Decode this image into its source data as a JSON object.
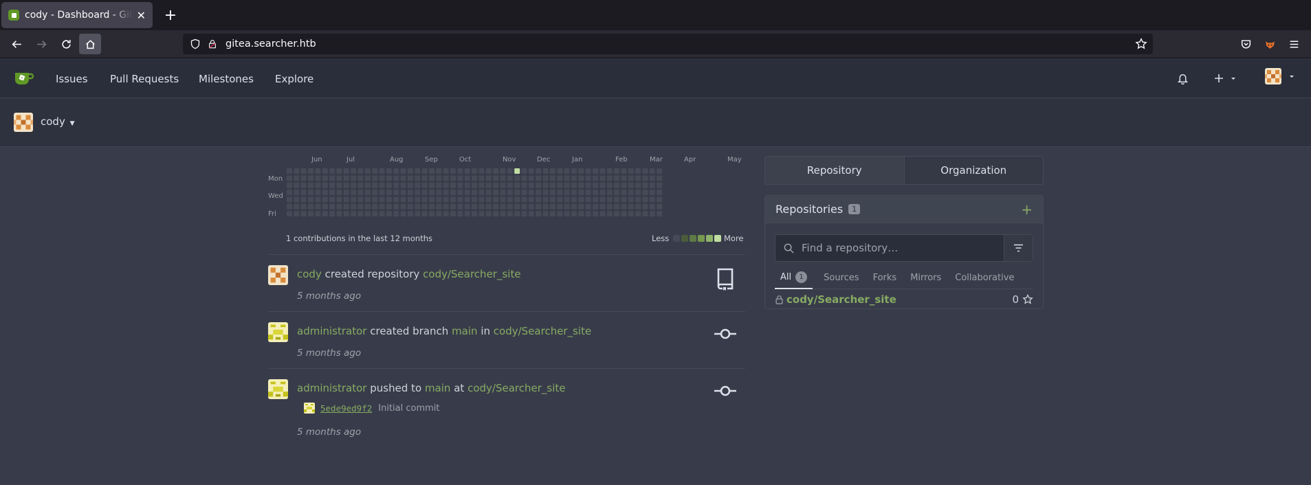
{
  "browser": {
    "tab_title": "cody - Dashboard - Gitea",
    "url": "gitea.searcher.htb"
  },
  "header": {
    "nav": [
      "Issues",
      "Pull Requests",
      "Milestones",
      "Explore"
    ]
  },
  "context_user": {
    "name": "cody"
  },
  "heatmap": {
    "months": [
      "Jun",
      "Jul",
      "Aug",
      "Sep",
      "Oct",
      "Nov",
      "Dec",
      "Jan",
      "Feb",
      "Mar",
      "Apr",
      "May"
    ],
    "days": [
      "Mon",
      "Wed",
      "Fri"
    ],
    "summary": "1 contributions in the last 12 months",
    "less": "Less",
    "more": "More",
    "colors": {
      "empty": "#454a57",
      "levels": [
        "#4b5c3a",
        "#5f7a45",
        "#76984f",
        "#8eb36b",
        "#c0dea2"
      ]
    }
  },
  "feed": [
    {
      "actor": "cody",
      "action": "created repository",
      "repo": "cody/Searcher_site",
      "time": "5 months ago",
      "icon": "repo-icon"
    },
    {
      "actor": "administrator",
      "action": "created branch",
      "branch": "main",
      "prep": "in",
      "repo": "cody/Searcher_site",
      "time": "5 months ago",
      "icon": "git-commit-icon"
    },
    {
      "actor": "administrator",
      "action": "pushed to",
      "branch": "main",
      "prep": "at",
      "repo": "cody/Searcher_site",
      "commit_sha": "5ede9ed9f2",
      "commit_msg": "Initial commit",
      "time": "5 months ago",
      "icon": "git-commit-icon"
    }
  ],
  "right": {
    "toggle": [
      "Repository",
      "Organization"
    ],
    "repos_title": "Repositories",
    "repos_count": "1",
    "search_placeholder": "Find a repository…",
    "tabs": [
      "All",
      "Sources",
      "Forks",
      "Mirrors",
      "Collaborative"
    ],
    "all_count": "1",
    "repo_name": "cody/Searcher_site",
    "repo_stars": "0"
  },
  "accent": "#87ab63"
}
